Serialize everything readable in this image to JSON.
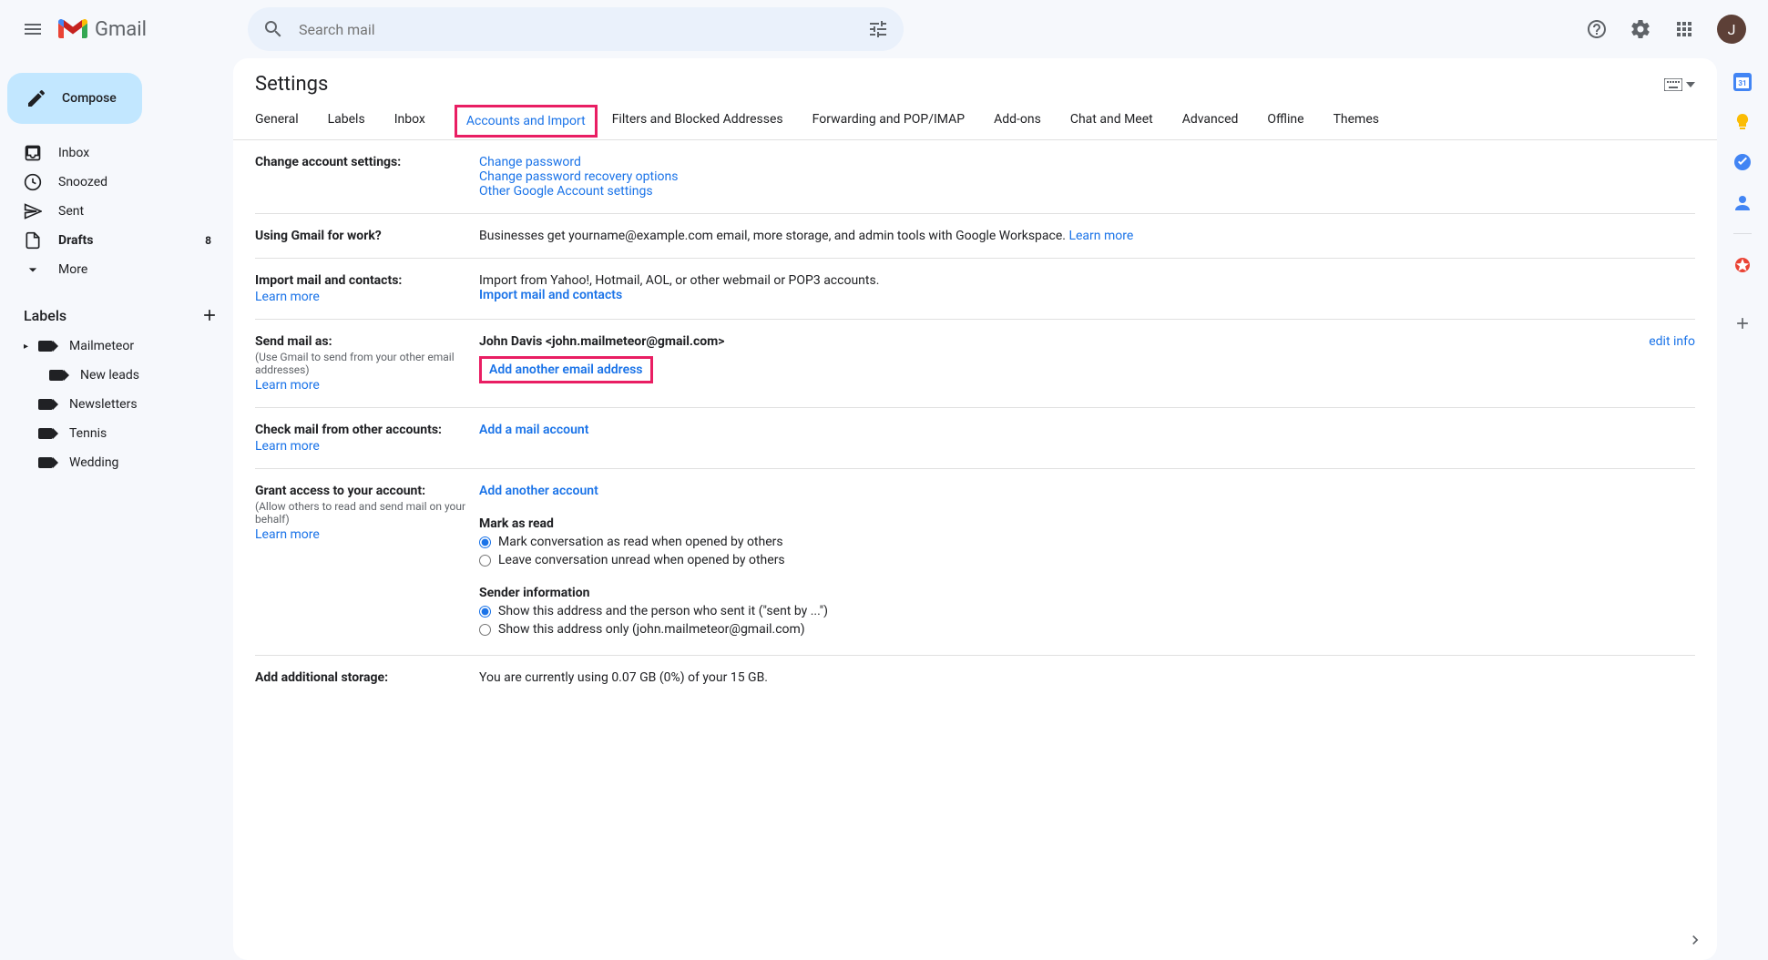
{
  "header": {
    "logo_text": "Gmail",
    "search_placeholder": "Search mail",
    "avatar_initial": "J"
  },
  "compose_label": "Compose",
  "nav": [
    {
      "label": "Inbox",
      "count": ""
    },
    {
      "label": "Snoozed",
      "count": ""
    },
    {
      "label": "Sent",
      "count": ""
    },
    {
      "label": "Drafts",
      "count": "8"
    },
    {
      "label": "More",
      "count": ""
    }
  ],
  "labels_header": "Labels",
  "labels": [
    {
      "label": "Mailmeteor",
      "expandable": true
    },
    {
      "label": "New leads",
      "child": true
    },
    {
      "label": "Newsletters"
    },
    {
      "label": "Tennis"
    },
    {
      "label": "Wedding"
    }
  ],
  "settings_title": "Settings",
  "tabs": [
    "General",
    "Labels",
    "Inbox",
    "Accounts and Import",
    "Filters and Blocked Addresses",
    "Forwarding and POP/IMAP",
    "Add-ons",
    "Chat and Meet",
    "Advanced",
    "Offline",
    "Themes"
  ],
  "active_tab": "Accounts and Import",
  "rows": {
    "change_account": {
      "label": "Change account settings:",
      "links": [
        "Change password",
        "Change password recovery options",
        "Other Google Account settings"
      ]
    },
    "work": {
      "label": "Using Gmail for work?",
      "text": "Businesses get yourname@example.com email, more storage, and admin tools with Google Workspace. ",
      "link": "Learn more"
    },
    "import": {
      "label": "Import mail and contacts:",
      "learn": "Learn more",
      "text": "Import from Yahoo!, Hotmail, AOL, or other webmail or POP3 accounts.",
      "link": "Import mail and contacts"
    },
    "send_as": {
      "label": "Send mail as:",
      "sub": "(Use Gmail to send from your other email addresses)",
      "learn": "Learn more",
      "identity": "John Davis <john.mailmeteor@gmail.com>",
      "add_link": "Add another email address",
      "edit": "edit info"
    },
    "check_mail": {
      "label": "Check mail from other accounts:",
      "learn": "Learn more",
      "link": "Add a mail account"
    },
    "grant": {
      "label": "Grant access to your account:",
      "sub": "(Allow others to read and send mail on your behalf)",
      "learn": "Learn more",
      "link": "Add another account",
      "mark_header": "Mark as read",
      "mark_opt1": "Mark conversation as read when opened by others",
      "mark_opt2": "Leave conversation unread when opened by others",
      "sender_header": "Sender information",
      "sender_opt1": "Show this address and the person who sent it (\"sent by ...\")",
      "sender_opt2": "Show this address only (john.mailmeteor@gmail.com)"
    },
    "storage": {
      "label": "Add additional storage:",
      "text": "You are currently using 0.07 GB (0%) of your 15 GB."
    }
  }
}
